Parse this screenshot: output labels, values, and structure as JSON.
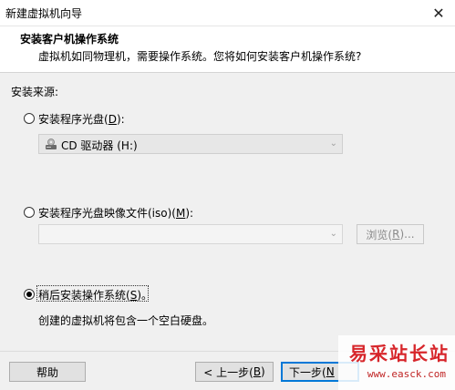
{
  "window": {
    "title": "新建虚拟机向导",
    "close_glyph": "✕"
  },
  "header": {
    "title": "安装客户机操作系统",
    "subtitle": "虚拟机如同物理机，需要操作系统。您将如何安装客户机操作系统?"
  },
  "source": {
    "label": "安装来源:",
    "options": [
      {
        "label_prefix": "安装程序光盘(",
        "hotkey": "D",
        "label_suffix": "):",
        "selected": false
      },
      {
        "label_prefix": "安装程序光盘映像文件(iso)(",
        "hotkey": "M",
        "label_suffix": "):",
        "selected": false
      },
      {
        "label_prefix": "稍后安装操作系统(",
        "hotkey": "S",
        "label_suffix": ")。",
        "selected": true
      }
    ],
    "cd_drive": {
      "value": "CD 驱动器 (H:)",
      "icon": "cd-drive-icon"
    },
    "iso_path": {
      "value": ""
    },
    "browse": {
      "label_prefix": "浏览(",
      "hotkey": "R",
      "label_suffix": ")..."
    },
    "later_description": "创建的虚拟机将包含一个空白硬盘。"
  },
  "buttons": {
    "help": "帮助",
    "back": {
      "label_prefix": "< 上一步(",
      "hotkey": "B",
      "label_suffix": ")"
    },
    "next": {
      "label_prefix": "下一步(",
      "hotkey": "N"
    }
  },
  "watermark": {
    "text": "易采站长站",
    "url": "www.easck.com",
    "color": "#d7262b"
  }
}
